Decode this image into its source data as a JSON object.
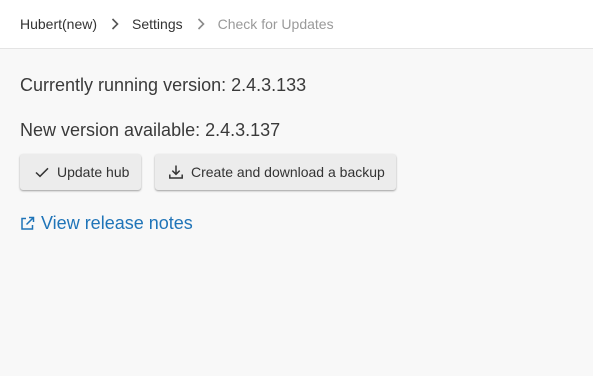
{
  "breadcrumb": {
    "items": [
      {
        "label": "Hubert(new)"
      },
      {
        "label": "Settings"
      },
      {
        "label": "Check for Updates"
      }
    ]
  },
  "versions": {
    "current": "Currently running version: 2.4.3.133",
    "available": "New version available: 2.4.3.137"
  },
  "actions": {
    "update_label": "Update hub",
    "update_icon": "check-icon",
    "backup_label": "Create and download a backup",
    "backup_icon": "download-icon"
  },
  "release_notes": {
    "label": "View release notes",
    "icon": "external-link-icon"
  },
  "colors": {
    "link": "#1f74b8",
    "background": "#f8f8f8",
    "button": "#ececec"
  }
}
